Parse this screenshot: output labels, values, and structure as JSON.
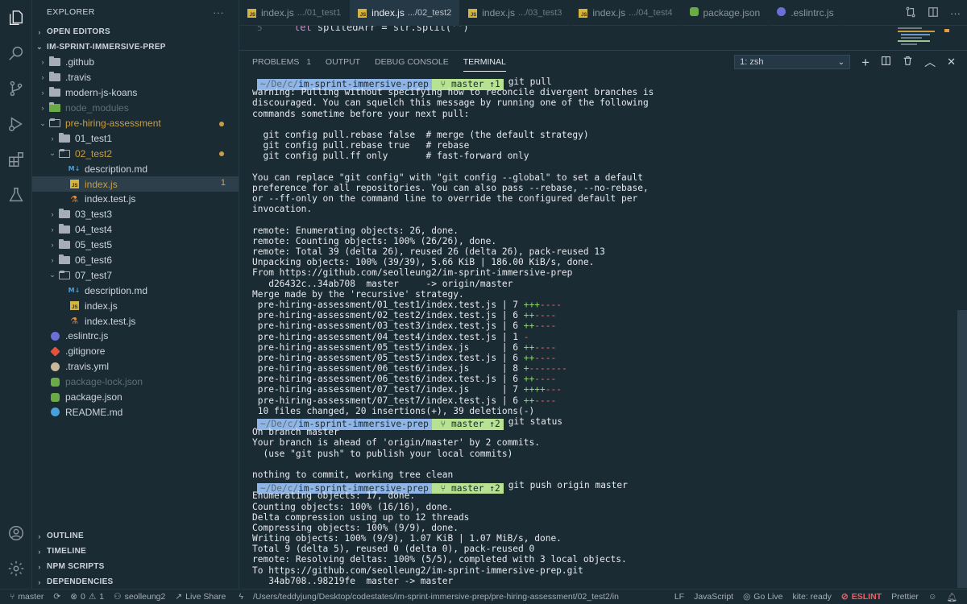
{
  "activity": {
    "items": [
      "explorer-icon",
      "search-icon",
      "source-control-icon",
      "run-debug-icon",
      "extensions-icon",
      "testing-icon"
    ],
    "bottom": [
      "accounts-icon",
      "settings-gear-icon"
    ]
  },
  "sidebar": {
    "title": "EXPLORER",
    "more": "···",
    "open_editors": "OPEN EDITORS",
    "root": "IM-SPRINT-IMMERSIVE-PREP",
    "tree": [
      {
        "label": ".github",
        "kind": "folder-gh",
        "indent": 1,
        "twisty": "›"
      },
      {
        "label": ".travis",
        "kind": "folder",
        "indent": 1,
        "twisty": "›"
      },
      {
        "label": "modern-js-koans",
        "kind": "folder",
        "indent": 1,
        "twisty": "›"
      },
      {
        "label": "node_modules",
        "kind": "folder-node",
        "indent": 1,
        "twisty": "›",
        "dim": true
      },
      {
        "label": "pre-hiring-assessment",
        "kind": "folder-open",
        "indent": 1,
        "twisty": "⌄",
        "color": "#c99e42",
        "dot": true
      },
      {
        "label": "01_test1",
        "kind": "folder",
        "indent": 2,
        "twisty": "›"
      },
      {
        "label": "02_test2",
        "kind": "folder-open",
        "indent": 2,
        "twisty": "⌄",
        "color": "#c99e42",
        "dot": true
      },
      {
        "label": "description.md",
        "kind": "md",
        "indent": 3
      },
      {
        "label": "index.js",
        "kind": "js",
        "indent": 3,
        "color": "#c99e42",
        "count": "1",
        "selected": true
      },
      {
        "label": "index.test.js",
        "kind": "test",
        "indent": 3
      },
      {
        "label": "03_test3",
        "kind": "folder",
        "indent": 2,
        "twisty": "›"
      },
      {
        "label": "04_test4",
        "kind": "folder",
        "indent": 2,
        "twisty": "›"
      },
      {
        "label": "05_test5",
        "kind": "folder",
        "indent": 2,
        "twisty": "›"
      },
      {
        "label": "06_test6",
        "kind": "folder",
        "indent": 2,
        "twisty": "›"
      },
      {
        "label": "07_test7",
        "kind": "folder-open",
        "indent": 2,
        "twisty": "⌄"
      },
      {
        "label": "description.md",
        "kind": "md",
        "indent": 3
      },
      {
        "label": "index.js",
        "kind": "js",
        "indent": 3
      },
      {
        "label": "index.test.js",
        "kind": "test",
        "indent": 3
      },
      {
        "label": ".eslintrc.js",
        "kind": "eslint",
        "indent": 1
      },
      {
        "label": ".gitignore",
        "kind": "git",
        "indent": 1
      },
      {
        "label": ".travis.yml",
        "kind": "travis",
        "indent": 1
      },
      {
        "label": "package-lock.json",
        "kind": "npm",
        "indent": 1,
        "dim": true
      },
      {
        "label": "package.json",
        "kind": "npm",
        "indent": 1
      },
      {
        "label": "README.md",
        "kind": "info",
        "indent": 1
      }
    ],
    "bottom_sections": [
      "OUTLINE",
      "TIMELINE",
      "NPM SCRIPTS",
      "DEPENDENCIES"
    ]
  },
  "tabs": [
    {
      "name": "index.js",
      "path": ".../01_test1",
      "icon": "js"
    },
    {
      "name": "index.js",
      "path": ".../02_test2",
      "icon": "js",
      "active": true
    },
    {
      "name": "index.js",
      "path": ".../03_test3",
      "icon": "js"
    },
    {
      "name": "index.js",
      "path": ".../04_test4",
      "icon": "js"
    },
    {
      "name": "package.json",
      "path": "",
      "icon": "npm"
    },
    {
      "name": ".eslintrc.js",
      "path": "",
      "icon": "eslint"
    }
  ],
  "editor": {
    "line_number": "5",
    "code_line": "let splitedArr = str.split('')"
  },
  "panel": {
    "tabs": [
      {
        "label": "PROBLEMS",
        "badge": "1"
      },
      {
        "label": "OUTPUT"
      },
      {
        "label": "DEBUG CONSOLE"
      },
      {
        "label": "TERMINAL",
        "active": true
      }
    ],
    "terminal_select": "1: zsh"
  },
  "terminal": {
    "prompt": {
      "apple": "",
      "path_dim": "~/De/c/",
      "path": "im-sprint-immersive-prep",
      "git_icon": "",
      "branch": "master"
    },
    "lines": [
      {
        "type": "prompt",
        "ahead": "↑1",
        "cmd": "git pull"
      },
      {
        "type": "text",
        "text": "warning: Pulling without specifying how to reconcile divergent branches is"
      },
      {
        "type": "text",
        "text": "discouraged. You can squelch this message by running one of the following"
      },
      {
        "type": "text",
        "text": "commands sometime before your next pull:"
      },
      {
        "type": "text",
        "text": ""
      },
      {
        "type": "text",
        "text": "  git config pull.rebase false  # merge (the default strategy)"
      },
      {
        "type": "text",
        "text": "  git config pull.rebase true   # rebase"
      },
      {
        "type": "text",
        "text": "  git config pull.ff only       # fast-forward only"
      },
      {
        "type": "text",
        "text": ""
      },
      {
        "type": "text",
        "text": "You can replace \"git config\" with \"git config --global\" to set a default"
      },
      {
        "type": "text",
        "text": "preference for all repositories. You can also pass --rebase, --no-rebase,"
      },
      {
        "type": "text",
        "text": "or --ff-only on the command line to override the configured default per"
      },
      {
        "type": "text",
        "text": "invocation."
      },
      {
        "type": "text",
        "text": ""
      },
      {
        "type": "text",
        "text": "remote: Enumerating objects: 26, done."
      },
      {
        "type": "text",
        "text": "remote: Counting objects: 100% (26/26), done."
      },
      {
        "type": "text",
        "text": "remote: Total 39 (delta 26), reused 26 (delta 26), pack-reused 13"
      },
      {
        "type": "text",
        "text": "Unpacking objects: 100% (39/39), 5.66 KiB | 186.00 KiB/s, done."
      },
      {
        "type": "text",
        "text": "From https://github.com/seolleung2/im-sprint-immersive-prep"
      },
      {
        "type": "text",
        "text": "   d26432c..34ab708  master     -> origin/master"
      },
      {
        "type": "text",
        "text": "Merge made by the 'recursive' strategy."
      },
      {
        "type": "diff",
        "file": " pre-hiring-assessment/01_test1/index.test.js | 7 ",
        "plus": "+++",
        "minus": "----"
      },
      {
        "type": "diff",
        "file": " pre-hiring-assessment/02_test2/index.test.js | 6 ",
        "plus": "++",
        "minus": "----"
      },
      {
        "type": "diff",
        "file": " pre-hiring-assessment/03_test3/index.test.js | 6 ",
        "plus": "++",
        "minus": "----"
      },
      {
        "type": "diff",
        "file": " pre-hiring-assessment/04_test4/index.test.js | 1 ",
        "plus": "",
        "minus": "-"
      },
      {
        "type": "diff",
        "file": " pre-hiring-assessment/05_test5/index.js      | 6 ",
        "plus": "++",
        "minus": "----"
      },
      {
        "type": "diff",
        "file": " pre-hiring-assessment/05_test5/index.test.js | 6 ",
        "plus": "++",
        "minus": "----"
      },
      {
        "type": "diff",
        "file": " pre-hiring-assessment/06_test6/index.js      | 8 ",
        "plus": "+",
        "minus": "-------"
      },
      {
        "type": "diff",
        "file": " pre-hiring-assessment/06_test6/index.test.js | 6 ",
        "plus": "++",
        "minus": "----"
      },
      {
        "type": "diff",
        "file": " pre-hiring-assessment/07_test7/index.js      | 7 ",
        "plus": "++++",
        "minus": "---"
      },
      {
        "type": "diff",
        "file": " pre-hiring-assessment/07_test7/index.test.js | 6 ",
        "plus": "++",
        "minus": "----"
      },
      {
        "type": "text",
        "text": " 10 files changed, 20 insertions(+), 39 deletions(-)"
      },
      {
        "type": "prompt",
        "ahead": "↑2",
        "cmd": "git status"
      },
      {
        "type": "text",
        "text": "On branch master"
      },
      {
        "type": "text",
        "text": "Your branch is ahead of 'origin/master' by 2 commits."
      },
      {
        "type": "text",
        "text": "  (use \"git push\" to publish your local commits)"
      },
      {
        "type": "text",
        "text": ""
      },
      {
        "type": "text",
        "text": "nothing to commit, working tree clean"
      },
      {
        "type": "prompt",
        "ahead": "↑2",
        "cmd": "git push origin master"
      },
      {
        "type": "text",
        "text": "Enumerating objects: 17, done."
      },
      {
        "type": "text",
        "text": "Counting objects: 100% (16/16), done."
      },
      {
        "type": "text",
        "text": "Delta compression using up to 12 threads"
      },
      {
        "type": "text",
        "text": "Compressing objects: 100% (9/9), done."
      },
      {
        "type": "text",
        "text": "Writing objects: 100% (9/9), 1.07 KiB | 1.07 MiB/s, done."
      },
      {
        "type": "text",
        "text": "Total 9 (delta 5), reused 0 (delta 0), pack-reused 0"
      },
      {
        "type": "text",
        "text": "remote: Resolving deltas: 100% (5/5), completed with 3 local objects."
      },
      {
        "type": "text",
        "text": "To https://github.com/seolleung2/im-sprint-immersive-prep.git"
      },
      {
        "type": "text",
        "text": "   34ab708..98219fe  master -> master"
      }
    ]
  },
  "status": {
    "branch": "master",
    "errors": "0",
    "warnings": "1",
    "user": "seolleung2",
    "live_share": "Live Share",
    "path": "/Users/teddyjung/Desktop/codestates/im-sprint-immersive-prep/pre-hiring-assessment/02_test2/in",
    "eol": "LF",
    "language": "JavaScript",
    "go_live": "Go Live",
    "kite": "kite: ready",
    "eslint": "ESLINT",
    "prettier": "Prettier"
  },
  "colors": {
    "bg": "#1b2b34",
    "accent_yellow": "#c99e42",
    "prompt_blue": "#8fb5e6",
    "prompt_green": "#b6e291",
    "diff_add": "#8ad66d",
    "diff_del": "#e86d6d",
    "eslint_err": "#ec5f67"
  }
}
